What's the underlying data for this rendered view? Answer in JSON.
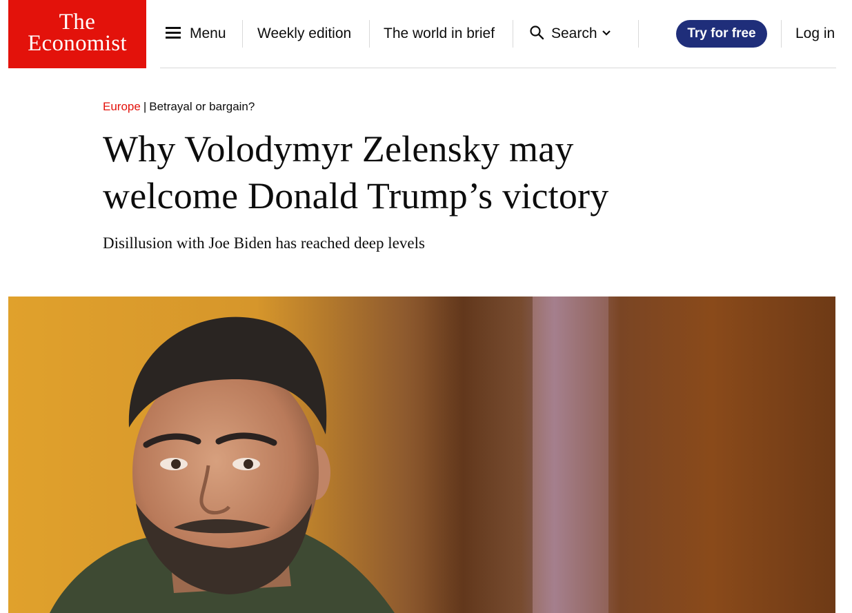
{
  "header": {
    "logo_line1": "The",
    "logo_line2": "Economist",
    "menu_label": "Menu",
    "weekly_label": "Weekly edition",
    "brief_label": "The world in brief",
    "search_label": "Search",
    "try_label": "Try for free",
    "login_label": "Log in"
  },
  "article": {
    "section": "Europe",
    "separator": "|",
    "flytitle": "Betrayal or bargain?",
    "headline_line1": "Why Volodymyr Zelensky may",
    "headline_line2": "welcome Donald Trump’s victory",
    "standfirst": "Disillusion with Joe Biden has reached deep levels"
  },
  "colors": {
    "brand_red": "#e3120b",
    "button_navy": "#1f2e7a"
  },
  "icons": {
    "menu": "hamburger-icon",
    "search": "magnifier-icon",
    "search_dropdown": "chevron-down-icon"
  }
}
